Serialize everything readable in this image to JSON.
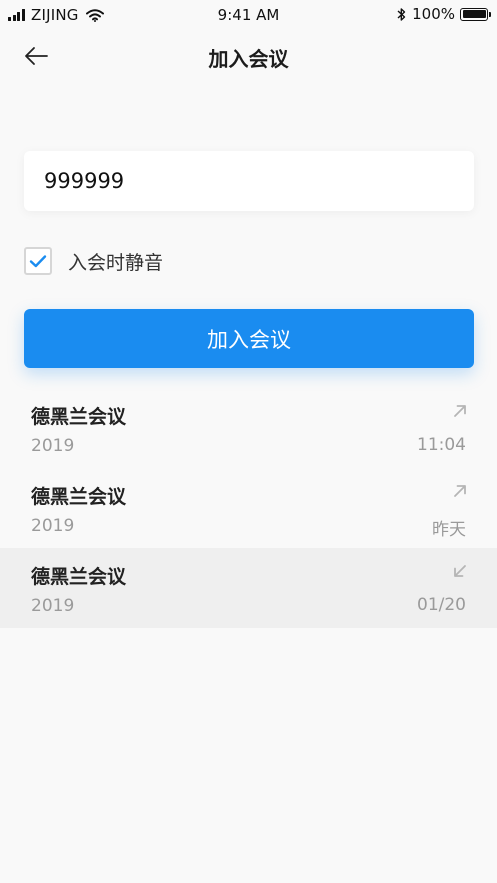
{
  "status_bar": {
    "carrier": "ZIJING",
    "time": "9:41 AM",
    "battery": "100%"
  },
  "header": {
    "title": "加入会议"
  },
  "form": {
    "meeting_id": "999999",
    "mute_label": "入会时静音",
    "mute_checked": true,
    "join_label": "加入会议"
  },
  "history": [
    {
      "title": "德黑兰会议",
      "sub": "2019",
      "time": "11:04",
      "direction": "outgoing"
    },
    {
      "title": "德黑兰会议",
      "sub": "2019",
      "time": "昨天",
      "direction": "outgoing"
    },
    {
      "title": "德黑兰会议",
      "sub": "2019",
      "time": "01/20",
      "direction": "incoming"
    }
  ],
  "colors": {
    "accent": "#1a8cf0",
    "background": "#f9f9f9",
    "secondary_text": "#9a9a9a",
    "selected_row": "#efefef"
  }
}
